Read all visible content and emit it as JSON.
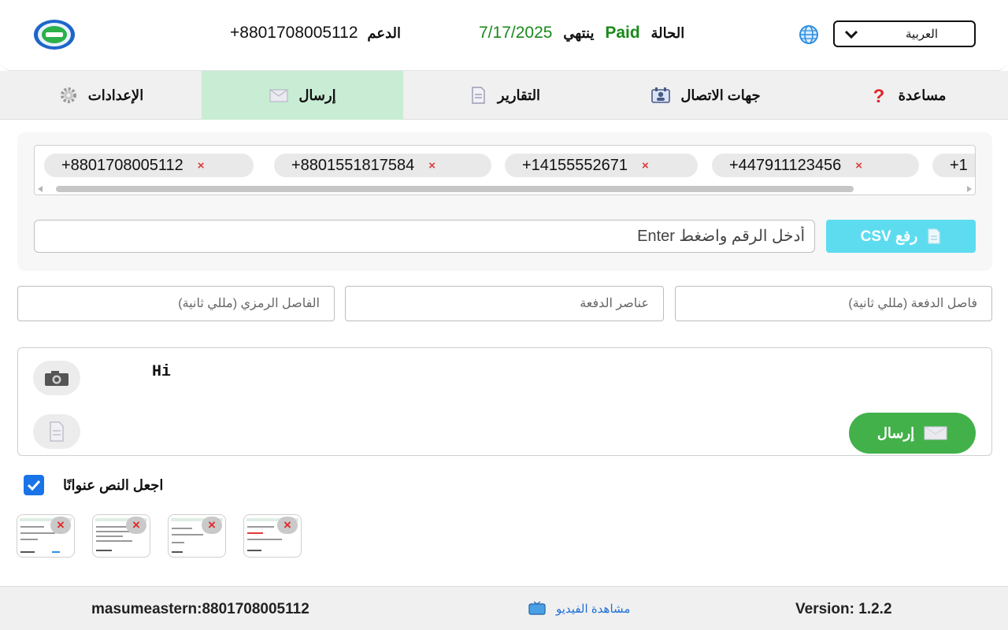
{
  "header": {
    "support_label": "الدعم",
    "support_phone": "+8801708005112",
    "status_label": "الحالة",
    "status_value": "Paid",
    "expires_label": "ينتهي",
    "expiry_date": "7/17/2025",
    "language_selected": "العربية"
  },
  "tabs": [
    {
      "label": "مساعدة",
      "icon": "question-icon"
    },
    {
      "label": "جهات الاتصال",
      "icon": "contacts-icon"
    },
    {
      "label": "التقارير",
      "icon": "document-icon"
    },
    {
      "label": "إرسال",
      "icon": "envelope-icon",
      "active": true
    },
    {
      "label": "الإعدادات",
      "icon": "gear-icon"
    }
  ],
  "recipients": {
    "chips": [
      "+8801708005112",
      "+8801551817584",
      "+14155552671",
      "+447911123456",
      "+1"
    ],
    "remove_symbol": "×"
  },
  "phone_input": {
    "placeholder": "أدخل الرقم واضغط Enter"
  },
  "csv_button": {
    "label": "رفع CSV"
  },
  "fields": {
    "batch_interval_placeholder": "فاصل الدفعة (مللي ثانية)",
    "batch_items_placeholder": "عناصر الدفعة",
    "symbolic_interval_placeholder": "الفاصل الرمزي (مللي ثانية)"
  },
  "message": {
    "text": "Hi",
    "send_label": "إرسال"
  },
  "caption_checkbox": {
    "label": "اجعل النص عنوانًا",
    "checked": true
  },
  "attachments": {
    "count": 4,
    "remove_symbol": "×"
  },
  "footer": {
    "user": "masumeastern:8801708005112",
    "video_link": "مشاهدة الفيديو",
    "version": "Version: 1.2.2"
  },
  "colors": {
    "accent_green": "#43b14a",
    "active_tab": "#c8ecd4",
    "csv_button": "#5ddcef",
    "paid_green": "#1a8a1a"
  }
}
